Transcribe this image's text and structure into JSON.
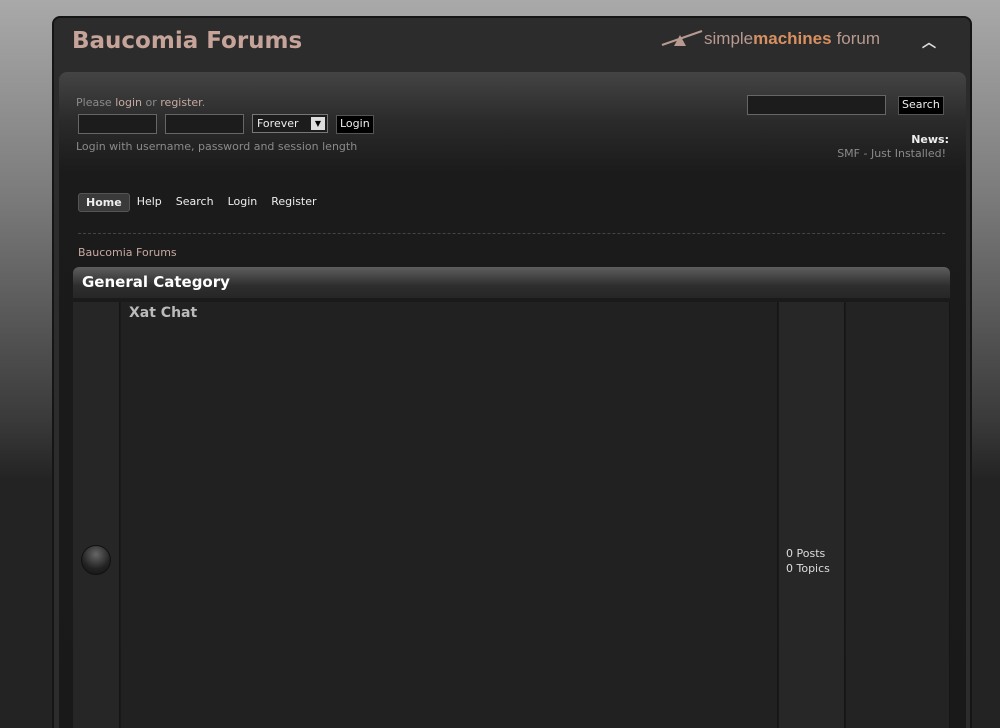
{
  "header": {
    "title": "Baucomia Forums",
    "logo": {
      "part1": "simple",
      "part2": "machines",
      "part3": "forum"
    }
  },
  "login": {
    "please": "Please",
    "login_link": "login",
    "or": "or",
    "register_link": "register",
    "period": ".",
    "session_value": "Forever",
    "login_button": "Login",
    "hint": "Login with username, password and session length"
  },
  "search": {
    "button": "Search",
    "value": ""
  },
  "news": {
    "label": "News:",
    "text": "SMF - Just Installed!"
  },
  "nav": [
    "Home",
    "Help",
    "Search",
    "Login",
    "Register"
  ],
  "breadcrumb": "Baucomia Forums",
  "category": {
    "title": "General Category",
    "boards": [
      {
        "name": "Xat Chat",
        "posts": "0 Posts",
        "topics": "0 Topics"
      }
    ]
  }
}
